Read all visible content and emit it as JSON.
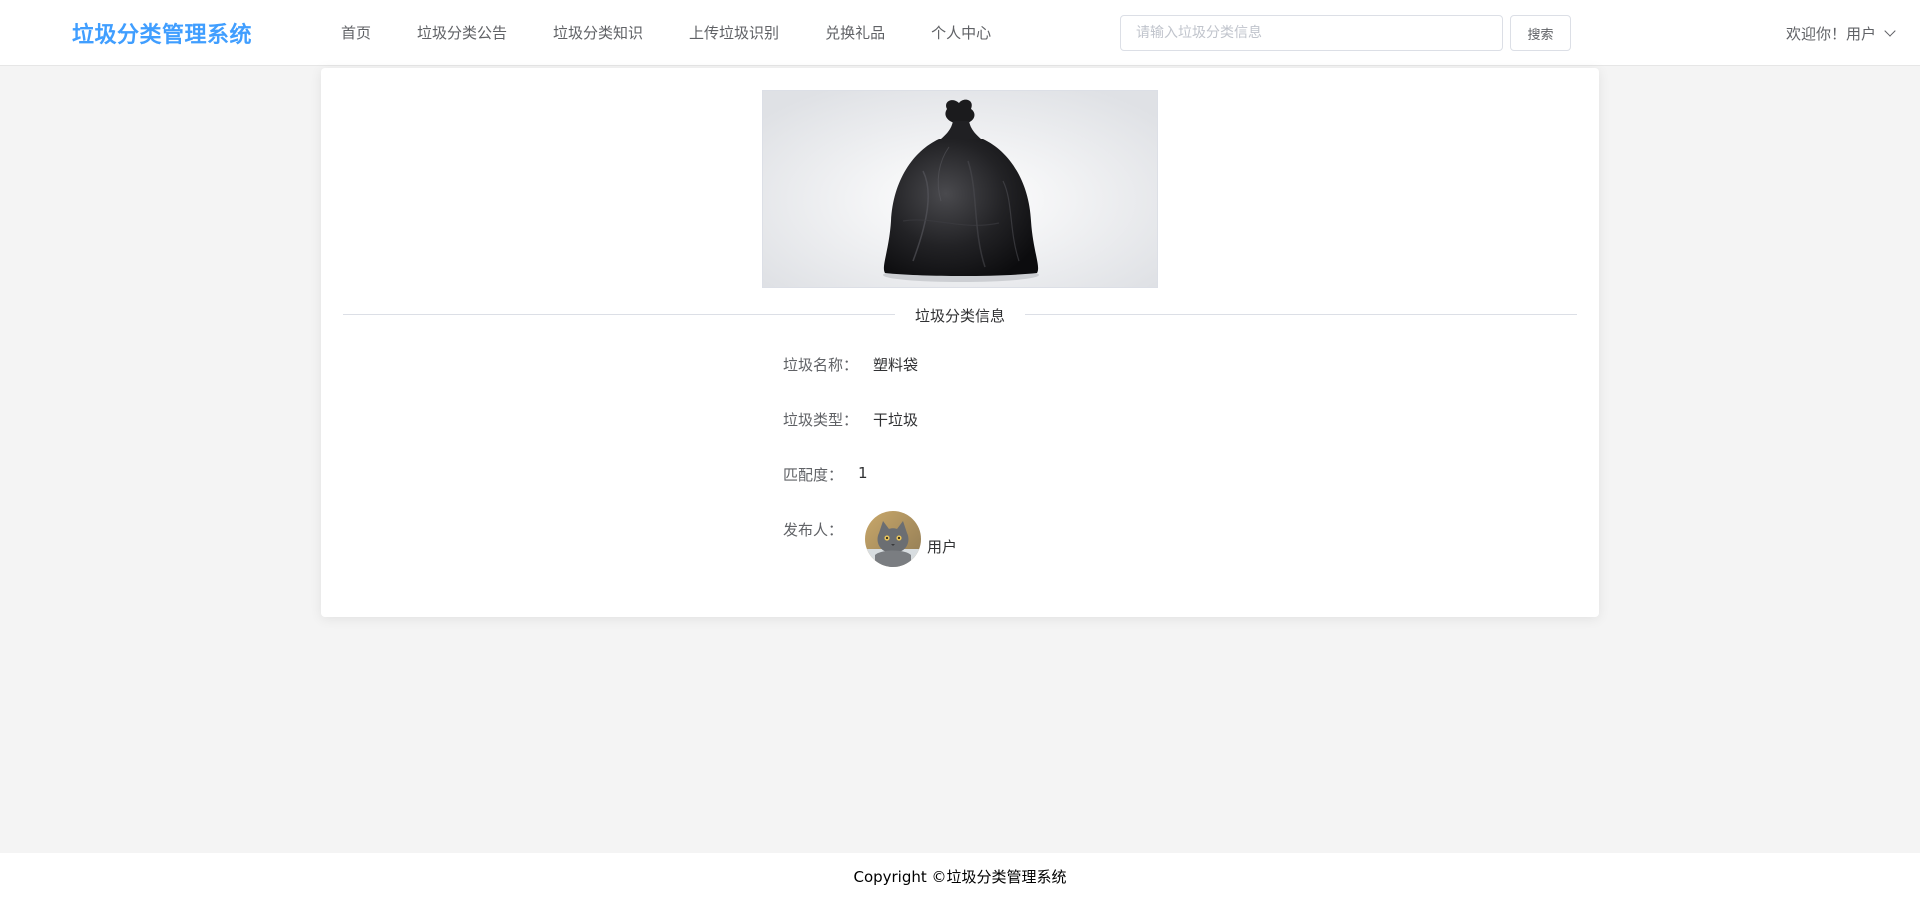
{
  "header": {
    "logo_text": "垃圾分类管理系统",
    "nav": [
      {
        "label": "首页"
      },
      {
        "label": "垃圾分类公告"
      },
      {
        "label": "垃圾分类知识"
      },
      {
        "label": "上传垃圾识别"
      },
      {
        "label": "兑换礼品"
      },
      {
        "label": "个人中心"
      }
    ],
    "search": {
      "placeholder": "请输入垃圾分类信息",
      "value": "",
      "button_label": "搜索"
    },
    "user_greeting": "欢迎你！用户"
  },
  "detail": {
    "image_alt": "black garbage bag",
    "section_title": "垃圾分类信息",
    "name_label": "垃圾名称：",
    "name_value": "塑料袋",
    "type_label": "垃圾类型：",
    "type_value": "干垃圾",
    "match_label": "匹配度：",
    "match_value": "1",
    "publisher_label": "发布人：",
    "publisher_name": "用户"
  },
  "footer": {
    "copyright": "Copyright ©垃圾分类管理系统"
  },
  "colors": {
    "brand": "#409eff",
    "page_bg": "#f4f4f4"
  }
}
